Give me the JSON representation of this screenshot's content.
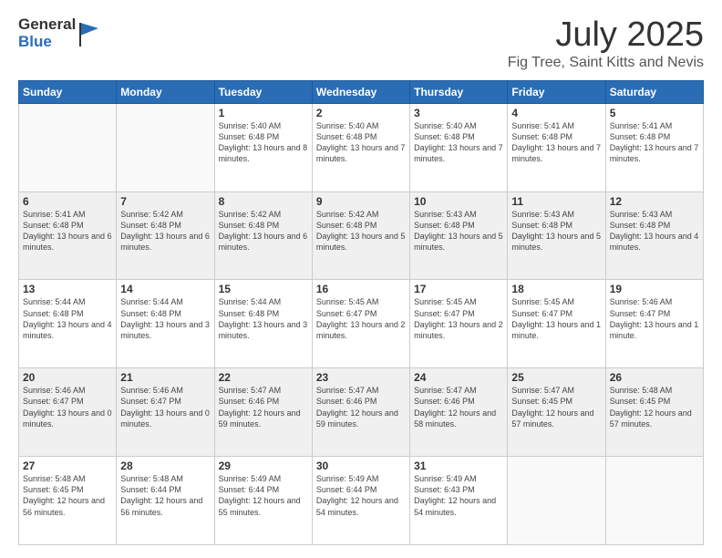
{
  "logo": {
    "general": "General",
    "blue": "Blue"
  },
  "title": "July 2025",
  "location": "Fig Tree, Saint Kitts and Nevis",
  "weekdays": [
    "Sunday",
    "Monday",
    "Tuesday",
    "Wednesday",
    "Thursday",
    "Friday",
    "Saturday"
  ],
  "weeks": [
    [
      {
        "day": "",
        "sunrise": "",
        "sunset": "",
        "daylight": ""
      },
      {
        "day": "",
        "sunrise": "",
        "sunset": "",
        "daylight": ""
      },
      {
        "day": "1",
        "sunrise": "Sunrise: 5:40 AM",
        "sunset": "Sunset: 6:48 PM",
        "daylight": "Daylight: 13 hours and 8 minutes."
      },
      {
        "day": "2",
        "sunrise": "Sunrise: 5:40 AM",
        "sunset": "Sunset: 6:48 PM",
        "daylight": "Daylight: 13 hours and 7 minutes."
      },
      {
        "day": "3",
        "sunrise": "Sunrise: 5:40 AM",
        "sunset": "Sunset: 6:48 PM",
        "daylight": "Daylight: 13 hours and 7 minutes."
      },
      {
        "day": "4",
        "sunrise": "Sunrise: 5:41 AM",
        "sunset": "Sunset: 6:48 PM",
        "daylight": "Daylight: 13 hours and 7 minutes."
      },
      {
        "day": "5",
        "sunrise": "Sunrise: 5:41 AM",
        "sunset": "Sunset: 6:48 PM",
        "daylight": "Daylight: 13 hours and 7 minutes."
      }
    ],
    [
      {
        "day": "6",
        "sunrise": "Sunrise: 5:41 AM",
        "sunset": "Sunset: 6:48 PM",
        "daylight": "Daylight: 13 hours and 6 minutes."
      },
      {
        "day": "7",
        "sunrise": "Sunrise: 5:42 AM",
        "sunset": "Sunset: 6:48 PM",
        "daylight": "Daylight: 13 hours and 6 minutes."
      },
      {
        "day": "8",
        "sunrise": "Sunrise: 5:42 AM",
        "sunset": "Sunset: 6:48 PM",
        "daylight": "Daylight: 13 hours and 6 minutes."
      },
      {
        "day": "9",
        "sunrise": "Sunrise: 5:42 AM",
        "sunset": "Sunset: 6:48 PM",
        "daylight": "Daylight: 13 hours and 5 minutes."
      },
      {
        "day": "10",
        "sunrise": "Sunrise: 5:43 AM",
        "sunset": "Sunset: 6:48 PM",
        "daylight": "Daylight: 13 hours and 5 minutes."
      },
      {
        "day": "11",
        "sunrise": "Sunrise: 5:43 AM",
        "sunset": "Sunset: 6:48 PM",
        "daylight": "Daylight: 13 hours and 5 minutes."
      },
      {
        "day": "12",
        "sunrise": "Sunrise: 5:43 AM",
        "sunset": "Sunset: 6:48 PM",
        "daylight": "Daylight: 13 hours and 4 minutes."
      }
    ],
    [
      {
        "day": "13",
        "sunrise": "Sunrise: 5:44 AM",
        "sunset": "Sunset: 6:48 PM",
        "daylight": "Daylight: 13 hours and 4 minutes."
      },
      {
        "day": "14",
        "sunrise": "Sunrise: 5:44 AM",
        "sunset": "Sunset: 6:48 PM",
        "daylight": "Daylight: 13 hours and 3 minutes."
      },
      {
        "day": "15",
        "sunrise": "Sunrise: 5:44 AM",
        "sunset": "Sunset: 6:48 PM",
        "daylight": "Daylight: 13 hours and 3 minutes."
      },
      {
        "day": "16",
        "sunrise": "Sunrise: 5:45 AM",
        "sunset": "Sunset: 6:47 PM",
        "daylight": "Daylight: 13 hours and 2 minutes."
      },
      {
        "day": "17",
        "sunrise": "Sunrise: 5:45 AM",
        "sunset": "Sunset: 6:47 PM",
        "daylight": "Daylight: 13 hours and 2 minutes."
      },
      {
        "day": "18",
        "sunrise": "Sunrise: 5:45 AM",
        "sunset": "Sunset: 6:47 PM",
        "daylight": "Daylight: 13 hours and 1 minute."
      },
      {
        "day": "19",
        "sunrise": "Sunrise: 5:46 AM",
        "sunset": "Sunset: 6:47 PM",
        "daylight": "Daylight: 13 hours and 1 minute."
      }
    ],
    [
      {
        "day": "20",
        "sunrise": "Sunrise: 5:46 AM",
        "sunset": "Sunset: 6:47 PM",
        "daylight": "Daylight: 13 hours and 0 minutes."
      },
      {
        "day": "21",
        "sunrise": "Sunrise: 5:46 AM",
        "sunset": "Sunset: 6:47 PM",
        "daylight": "Daylight: 13 hours and 0 minutes."
      },
      {
        "day": "22",
        "sunrise": "Sunrise: 5:47 AM",
        "sunset": "Sunset: 6:46 PM",
        "daylight": "Daylight: 12 hours and 59 minutes."
      },
      {
        "day": "23",
        "sunrise": "Sunrise: 5:47 AM",
        "sunset": "Sunset: 6:46 PM",
        "daylight": "Daylight: 12 hours and 59 minutes."
      },
      {
        "day": "24",
        "sunrise": "Sunrise: 5:47 AM",
        "sunset": "Sunset: 6:46 PM",
        "daylight": "Daylight: 12 hours and 58 minutes."
      },
      {
        "day": "25",
        "sunrise": "Sunrise: 5:47 AM",
        "sunset": "Sunset: 6:45 PM",
        "daylight": "Daylight: 12 hours and 57 minutes."
      },
      {
        "day": "26",
        "sunrise": "Sunrise: 5:48 AM",
        "sunset": "Sunset: 6:45 PM",
        "daylight": "Daylight: 12 hours and 57 minutes."
      }
    ],
    [
      {
        "day": "27",
        "sunrise": "Sunrise: 5:48 AM",
        "sunset": "Sunset: 6:45 PM",
        "daylight": "Daylight: 12 hours and 56 minutes."
      },
      {
        "day": "28",
        "sunrise": "Sunrise: 5:48 AM",
        "sunset": "Sunset: 6:44 PM",
        "daylight": "Daylight: 12 hours and 56 minutes."
      },
      {
        "day": "29",
        "sunrise": "Sunrise: 5:49 AM",
        "sunset": "Sunset: 6:44 PM",
        "daylight": "Daylight: 12 hours and 55 minutes."
      },
      {
        "day": "30",
        "sunrise": "Sunrise: 5:49 AM",
        "sunset": "Sunset: 6:44 PM",
        "daylight": "Daylight: 12 hours and 54 minutes."
      },
      {
        "day": "31",
        "sunrise": "Sunrise: 5:49 AM",
        "sunset": "Sunset: 6:43 PM",
        "daylight": "Daylight: 12 hours and 54 minutes."
      },
      {
        "day": "",
        "sunrise": "",
        "sunset": "",
        "daylight": ""
      },
      {
        "day": "",
        "sunrise": "",
        "sunset": "",
        "daylight": ""
      }
    ]
  ]
}
